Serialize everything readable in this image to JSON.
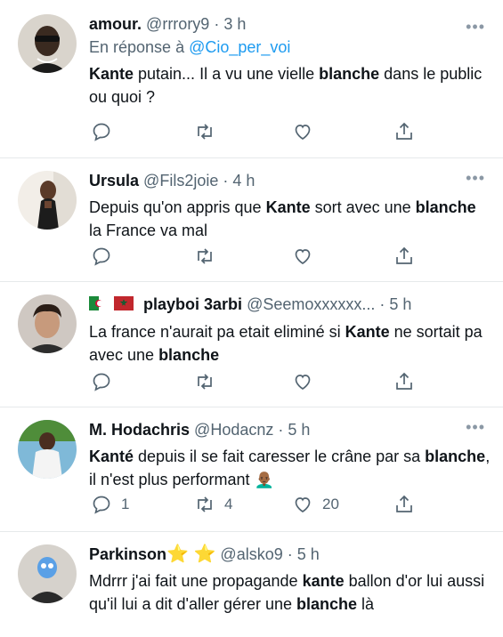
{
  "tweets": [
    {
      "name": "amour.",
      "handle": "@rrrory9",
      "time": "3 h",
      "reply_prefix": "En réponse à ",
      "reply_to": "@Cio_per_voi",
      "text_html": "<b>Kante</b> putain... Il a vu une vielle <b>blanche</b> dans le public ou quoi ?",
      "replies": "",
      "retweets": "",
      "likes": ""
    },
    {
      "name": "Ursula",
      "handle": "@Fils2joie",
      "time": "4 h",
      "text_html": "Depuis qu'on appris que <b>Kante</b> sort avec une <b>blanche</b> la France va mal",
      "replies": "",
      "retweets": "",
      "likes": ""
    },
    {
      "name": "playboi 3arbi",
      "handle": "@Seemoxxxxxx...",
      "time": "5 h",
      "flags": [
        "algeria-flag",
        "morocco-flag"
      ],
      "text_html": "La france n'aurait pa etait eliminé si <b>Kante</b> ne sortait pa avec une <b>blanche</b>",
      "replies": "",
      "retweets": "",
      "likes": ""
    },
    {
      "name": "M. Hodachris",
      "handle": "@Hodacnz",
      "time": "5 h",
      "text_html": "<b>Kanté</b> depuis il se fait caresser le crâne par sa <b>blanche</b>, il n'est plus performant 👨🏾‍🦲",
      "replies": "1",
      "retweets": "4",
      "likes": "20"
    },
    {
      "name": "Parkinson",
      "name_emoji": "⭐ ⭐",
      "handle": "@alsko9",
      "time": "5 h",
      "text_html": "Mdrrr j'ai fait une propagande <b>kante</b> ballon d'or lui aussi qu'il lui a dit d'aller gérer une <b>blanche</b> là",
      "replies": "",
      "retweets": "",
      "likes": ""
    }
  ],
  "ui": {
    "more_label": "•••",
    "dot": " · "
  }
}
